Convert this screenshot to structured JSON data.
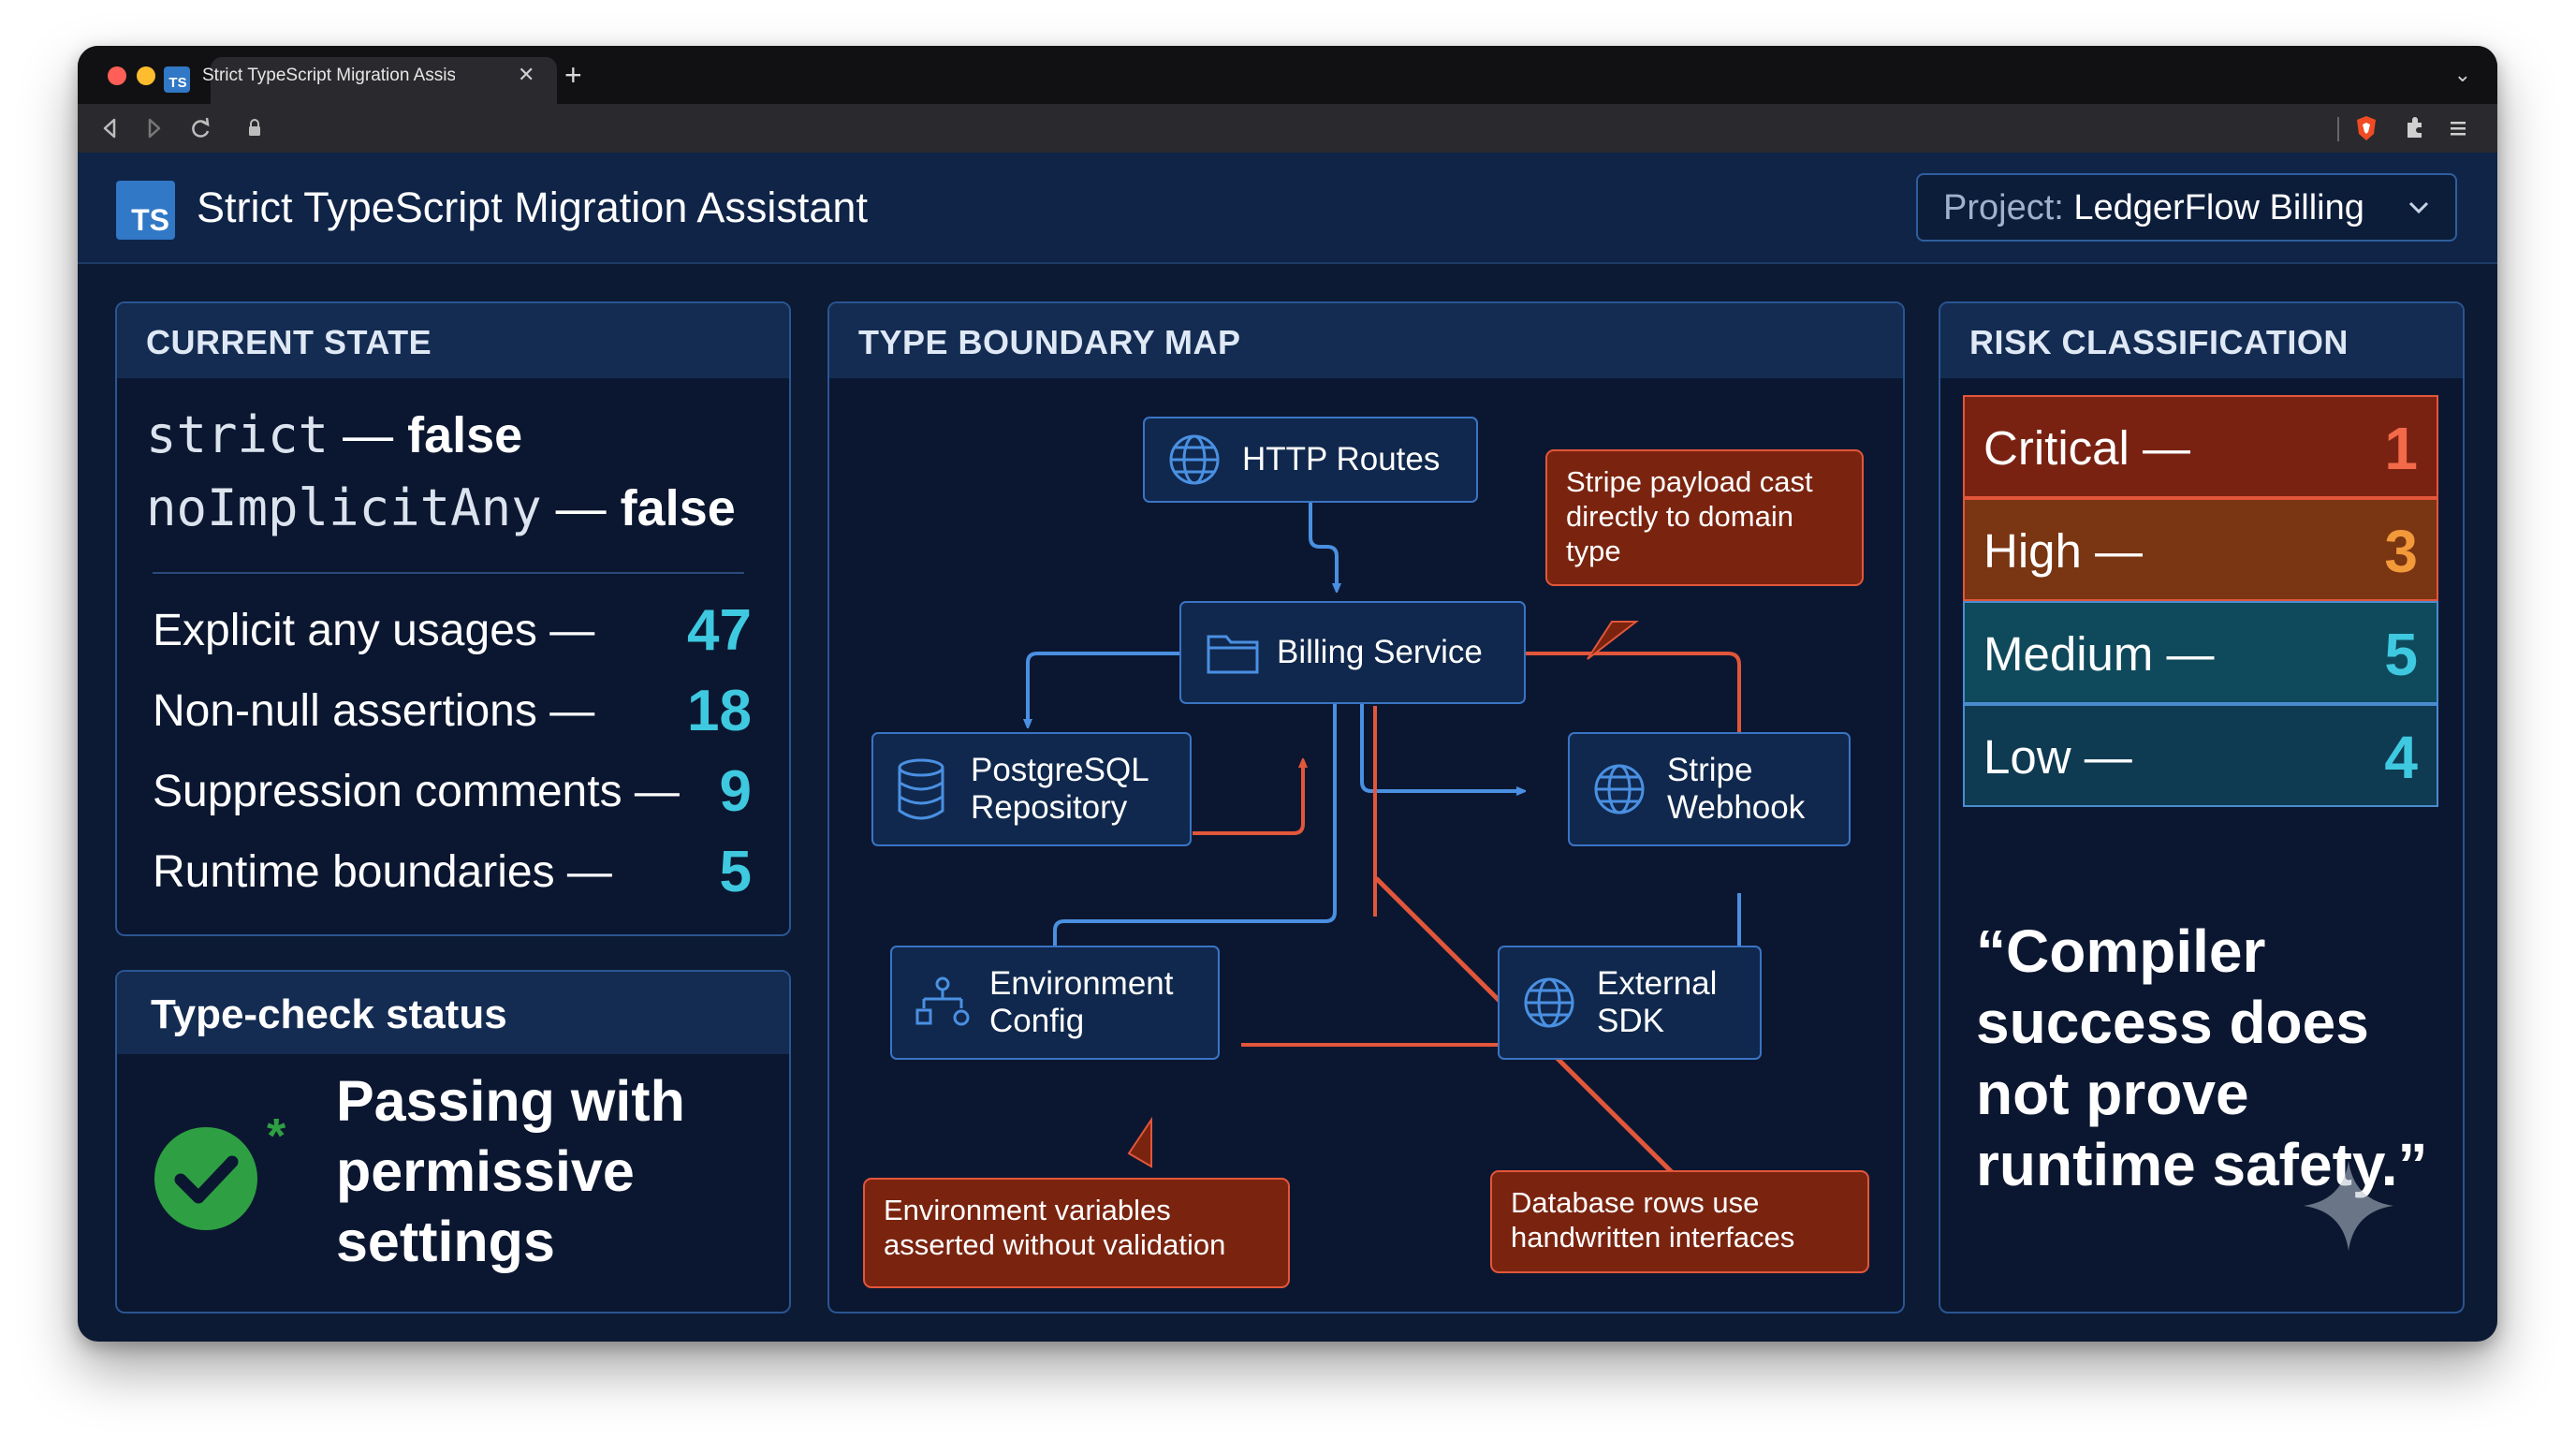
{
  "browser": {
    "tab_title": "Strict TypeScript Migration Assistant",
    "tab_favicon": "TS",
    "traffic_lights": [
      "#ff5f57",
      "#febc2e",
      "#28c840"
    ],
    "icons": [
      "back-icon",
      "forward-icon",
      "reload-icon",
      "lock-icon",
      "brave-shield-icon",
      "extensions-icon",
      "menu-icon"
    ]
  },
  "header": {
    "logo": "TS",
    "title": "Strict TypeScript Migration Assistant",
    "project_label": "Project:",
    "project_value": "LedgerFlow Billing"
  },
  "current_state": {
    "heading": "CURRENT STATE",
    "flags": [
      {
        "name": "strict",
        "value": "false"
      },
      {
        "name": "noImplicitAny",
        "value": "false"
      }
    ],
    "metrics": [
      {
        "label": "Explicit any usages —",
        "value": "47"
      },
      {
        "label": "Non-null assertions —",
        "value": "18"
      },
      {
        "label": "Suppression comments —",
        "value": "9"
      },
      {
        "label": "Runtime boundaries —",
        "value": "5"
      }
    ]
  },
  "type_check": {
    "heading": "Type-check status",
    "status": "Passing with permissive settings",
    "asterisk": "*"
  },
  "boundary_map": {
    "heading": "TYPE BOUNDARY MAP",
    "nodes": {
      "http": "HTTP Routes",
      "billing": "Billing Service",
      "postgres": "PostgreSQL Repository",
      "stripe": "Stripe Webhook",
      "env": "Environment Config",
      "sdk": "External SDK"
    },
    "callouts": {
      "stripe_payload": "Stripe payload cast directly to domain type",
      "env_vars": "Environment variables asserted without validation",
      "db_rows": "Database rows use handwritten interfaces"
    },
    "colors": {
      "safe_edge": "#4a90e2",
      "risk_edge": "#e2563a"
    }
  },
  "risk": {
    "heading": "RISK CLASSIFICATION",
    "levels": [
      {
        "label": "Critical —",
        "count": "1",
        "bg": "#7a2212",
        "num_color": "#f26a4a"
      },
      {
        "label": "High —",
        "count": "3",
        "bg": "#7a3512",
        "num_color": "#f29a3a"
      },
      {
        "label": "Medium —",
        "count": "5",
        "bg": "#0f4a5c",
        "num_color": "#3ec9e0"
      },
      {
        "label": "Low —",
        "count": "4",
        "bg": "#0e3a52",
        "num_color": "#3ec9e0"
      }
    ],
    "quote": "“Compiler success does not prove runtime safety.”"
  }
}
